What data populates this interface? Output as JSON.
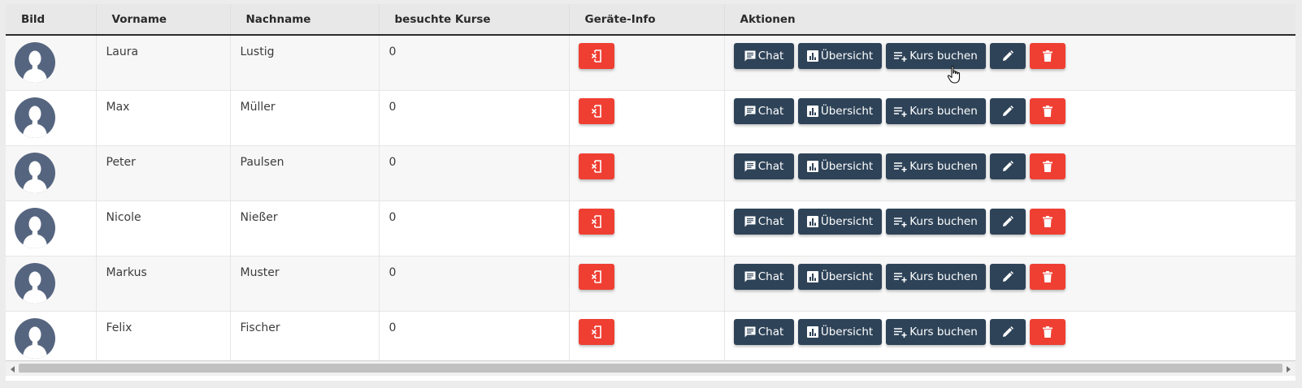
{
  "table": {
    "headers": [
      "Bild",
      "Vorname",
      "Nachname",
      "besuchte Kurse",
      "Geräte-Info",
      "Aktionen"
    ],
    "rows": [
      {
        "vorname": "Laura",
        "nachname": "Lustig",
        "kurse": "0"
      },
      {
        "vorname": "Max",
        "nachname": "Müller",
        "kurse": "0"
      },
      {
        "vorname": "Peter",
        "nachname": "Paulsen",
        "kurse": "0"
      },
      {
        "vorname": "Nicole",
        "nachname": "Nießer",
        "kurse": "0"
      },
      {
        "vorname": "Markus",
        "nachname": "Muster",
        "kurse": "0"
      },
      {
        "vorname": "Felix",
        "nachname": "Fischer",
        "kurse": "0"
      }
    ]
  },
  "actions": {
    "chat_label": "Chat",
    "overview_label": "Übersicht",
    "book_course_label": "Kurs buchen"
  },
  "icons": {
    "avatar": "user-placeholder-icon",
    "device_info": "device-info-icon",
    "chat": "chat-icon",
    "overview": "bar-chart-icon",
    "book_course": "playlist-add-icon",
    "edit": "pencil-icon",
    "delete": "trash-icon"
  },
  "colors": {
    "primary_button": "#2e4358",
    "danger_button": "#ef3f33",
    "header_background": "#e8e8e8",
    "avatar_background": "#56657f"
  }
}
